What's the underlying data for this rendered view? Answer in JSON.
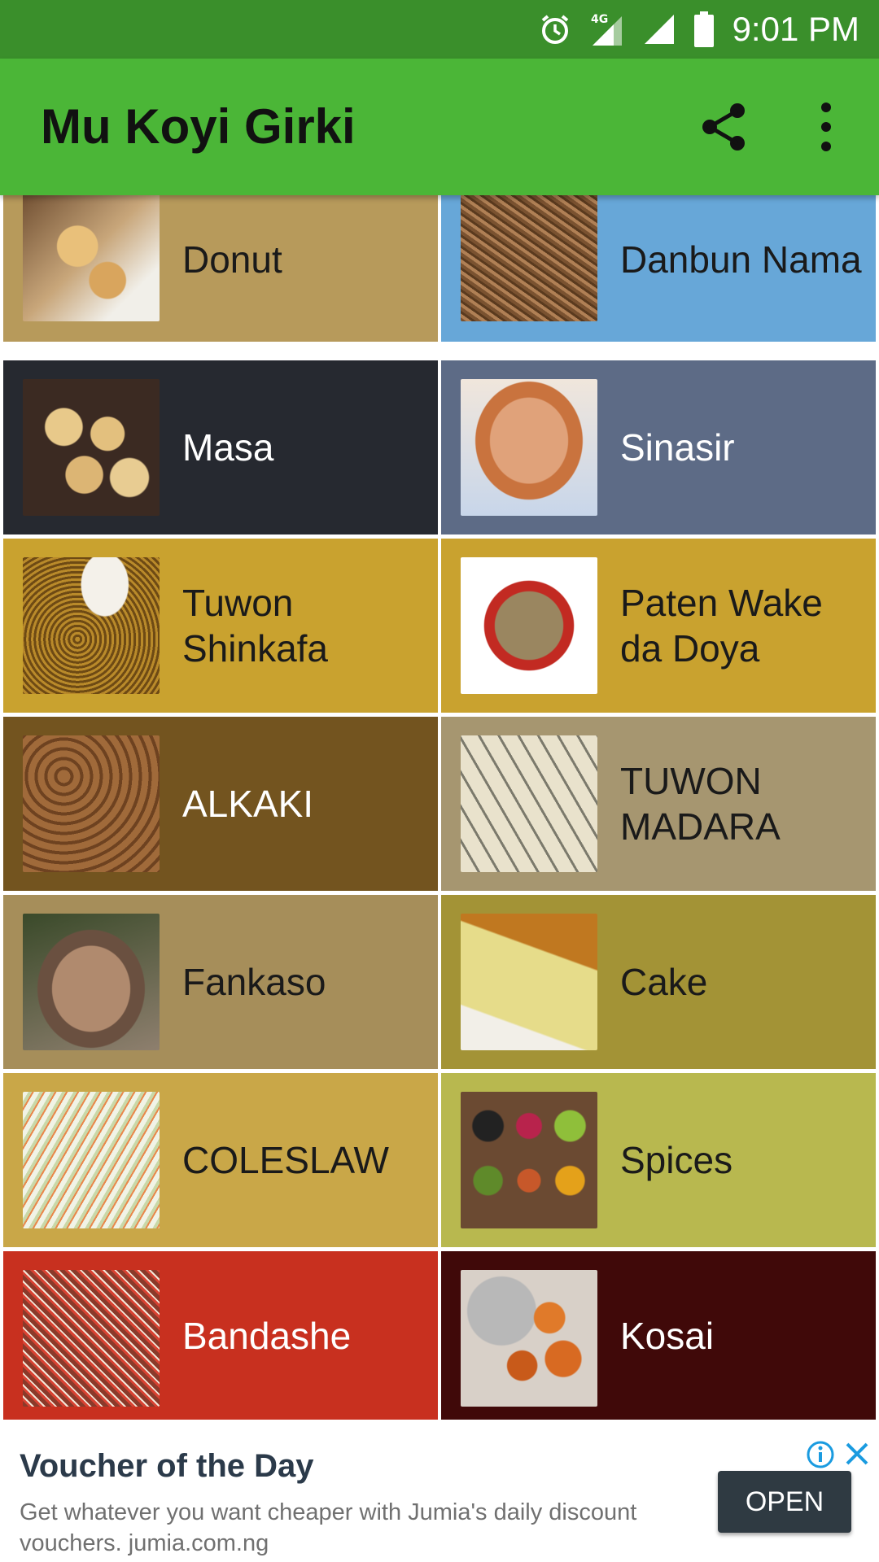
{
  "status_bar": {
    "time": "9:01 PM",
    "network": "4G",
    "icons": [
      "alarm-icon",
      "signal-4g-icon",
      "signal-icon",
      "battery-icon"
    ]
  },
  "app_bar": {
    "title": "Mu Koyi Girki",
    "actions": [
      "share-icon",
      "more-vert-icon"
    ]
  },
  "recipes": [
    {
      "label": "Donut",
      "color": "#b79a5b",
      "dark": false,
      "image": "donut-photo"
    },
    {
      "label": "Danbun Nama",
      "color": "#67a7d8",
      "dark": false,
      "image": "danbun-nama-photo"
    },
    {
      "label": "Masa",
      "color": "#262930",
      "dark": true,
      "image": "masa-photo"
    },
    {
      "label": "Sinasir",
      "color": "#5d6b86",
      "dark": true,
      "image": "sinasir-photo"
    },
    {
      "label": "Tuwon Shinkafa",
      "color": "#c9a22f",
      "dark": false,
      "image": "tuwon-shinkafa-photo"
    },
    {
      "label": "Paten Wake da Doya",
      "color": "#c9a22f",
      "dark": false,
      "image": "paten-wake-photo"
    },
    {
      "label": "ALKAKI",
      "color": "#73541f",
      "dark": true,
      "image": "alkaki-photo"
    },
    {
      "label": "TUWON MADARA",
      "color": "#a69670",
      "dark": false,
      "image": "tuwon-madara-photo"
    },
    {
      "label": "Fankaso",
      "color": "#a68e5a",
      "dark": false,
      "image": "fankaso-photo"
    },
    {
      "label": "Cake",
      "color": "#a39336",
      "dark": false,
      "image": "cake-photo"
    },
    {
      "label": "COLESLAW",
      "color": "#c9a748",
      "dark": false,
      "image": "coleslaw-photo"
    },
    {
      "label": "Spices",
      "color": "#b8b84f",
      "dark": false,
      "image": "spices-photo"
    },
    {
      "label": "Bandashe",
      "color": "#c8301f",
      "dark": true,
      "image": "bandashe-photo"
    },
    {
      "label": "Kosai",
      "color": "#400909",
      "dark": true,
      "image": "kosai-photo"
    }
  ],
  "ad": {
    "title": "Voucher of the Day",
    "body": "Get whatever you want cheaper with Jumia's daily discount vouchers. jumia.com.ng",
    "button": "OPEN"
  }
}
